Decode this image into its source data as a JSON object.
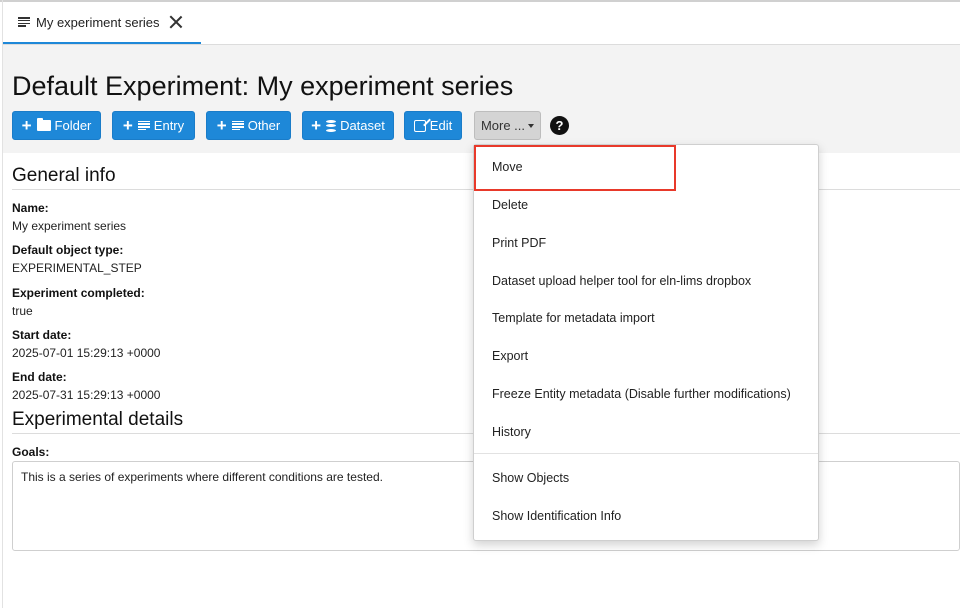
{
  "tab": {
    "label": "My experiment series",
    "icon": "list-icon",
    "close_icon": "close-icon"
  },
  "header": {
    "title": "Default Experiment: My experiment series",
    "buttons": {
      "folder": "Folder",
      "entry": "Entry",
      "other": "Other",
      "dataset": "Dataset",
      "edit": "Edit",
      "more": "More ..."
    },
    "help": "?"
  },
  "general_info": {
    "title": "General info",
    "fields": [
      {
        "label": "Name:",
        "value": "My experiment series"
      },
      {
        "label": "Default object type:",
        "value": "EXPERIMENTAL_STEP"
      },
      {
        "label": "Experiment completed:",
        "value": "true"
      },
      {
        "label": "Start date:",
        "value": "2025-07-01 15:29:13 +0000"
      },
      {
        "label": "End date:",
        "value": "2025-07-31 15:29:13 +0000"
      }
    ]
  },
  "experimental_details": {
    "title": "Experimental details",
    "goals_label": "Goals:",
    "goals_text": "This is a series of experiments where different conditions are tested."
  },
  "more_menu": {
    "items": [
      "Move",
      "Delete",
      "Print PDF",
      "Dataset upload helper tool for eln-lims dropbox",
      "Template for metadata import",
      "Export",
      "Freeze Entity metadata (Disable further modifications)",
      "History",
      "Show Objects",
      "Show Identification Info"
    ],
    "highlighted": "Move"
  },
  "colors": {
    "accent": "#1e88d8",
    "highlight": "#e8392a",
    "header_bg": "#f3f3f3"
  }
}
